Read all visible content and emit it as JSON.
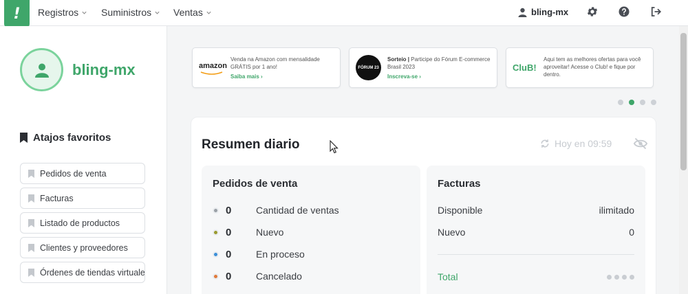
{
  "nav": {
    "logo": "!",
    "items": [
      {
        "label": "Registros"
      },
      {
        "label": "Suministros"
      },
      {
        "label": "Ventas"
      }
    ],
    "account": "bling-mx",
    "icons": [
      "user-icon",
      "gear-icon",
      "help-icon",
      "logout-icon"
    ]
  },
  "sidebar": {
    "username": "bling-mx",
    "favorites_title": "Atajos favoritos",
    "favorites": [
      {
        "label": "Pedidos de venta"
      },
      {
        "label": "Facturas"
      },
      {
        "label": "Listado de productos"
      },
      {
        "label": "Clientes y proveedores"
      },
      {
        "label": "Órdenes de tiendas virtuales"
      }
    ]
  },
  "banners": [
    {
      "logo": "amazon",
      "text": "Venda na Amazon com mensalidade GRÁTIS por 1 ano!",
      "link": "Saiba mais"
    },
    {
      "logo": "FÓRUM 23",
      "text_bold": "Sorteio |",
      "text": "Participe do Fórum E-commerce Brasil 2023",
      "link": "Inscreva-se"
    },
    {
      "logo": "CluB!",
      "text": "Aqui tem as melhores ofertas para você aproveitar! Acesse o Club! e fique por dentro."
    }
  ],
  "carousel": {
    "count": 4,
    "active": 1
  },
  "resumen": {
    "title": "Resumen diario",
    "updated": "Hoy en 09:59",
    "pedidos": {
      "title": "Pedidos de venta",
      "rows": [
        {
          "value": "0",
          "label": "Cantidad de ventas",
          "color": "#9aa0a6"
        },
        {
          "value": "0",
          "label": "Nuevo",
          "color": "#9a9a2e"
        },
        {
          "value": "0",
          "label": "En proceso",
          "color": "#3b8fd8"
        },
        {
          "value": "0",
          "label": "Cancelado",
          "color": "#e07a3a"
        }
      ]
    },
    "facturas": {
      "title": "Facturas",
      "rows": [
        {
          "label": "Disponible",
          "value": "ilimitado"
        },
        {
          "label": "Nuevo",
          "value": "0"
        }
      ],
      "total_label": "Total"
    }
  },
  "colors": {
    "brand": "#3fa66a",
    "accent_light": "#7bd39c"
  }
}
